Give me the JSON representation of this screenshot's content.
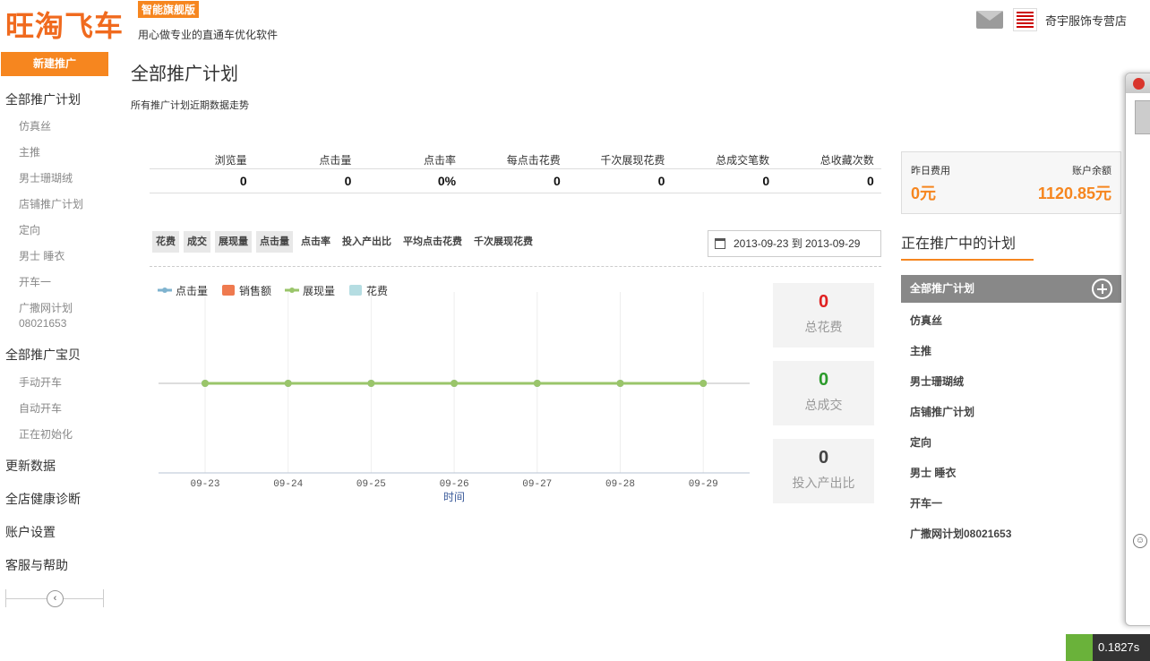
{
  "header": {
    "logo": "旺淘飞车",
    "edition": "智能旗舰版",
    "slogan": "用心做专业的直通车优化软件",
    "shop_name": "奇宇服饰专营店"
  },
  "sidebar": {
    "new_button": "新建推广",
    "groups": [
      {
        "label": "全部推广计划",
        "items": [
          "仿真丝",
          "主推",
          "男士珊瑚绒",
          "店铺推广计划",
          "定向",
          "男士 睡衣",
          "开车一",
          "广撒网计划",
          "08021653"
        ]
      },
      {
        "label": "全部推广宝贝",
        "items": [
          "手动开车",
          "自动开车",
          "正在初始化"
        ]
      },
      {
        "label": "更新数据"
      },
      {
        "label": "全店健康诊断"
      },
      {
        "label": "账户设置"
      },
      {
        "label": "客服与帮助"
      }
    ],
    "collapse_icon": "‹"
  },
  "main": {
    "title": "全部推广计划",
    "subtitle": "所有推广计划近期数据走势",
    "stats": {
      "headers": [
        "浏览量",
        "点击量",
        "点击率",
        "每点击花费",
        "千次展现花费",
        "总成交笔数",
        "总收藏次数"
      ],
      "values": [
        "0",
        "0",
        "0%",
        "0",
        "0",
        "0",
        "0"
      ]
    },
    "metric_tabs": [
      "花费",
      "成交",
      "展现量",
      "点击量",
      "点击率",
      "投入产出比",
      "平均点击花费",
      "千次展现花费"
    ],
    "date_range": "2013-09-23 到 2013-09-29",
    "cards": [
      {
        "value": "0",
        "label": "总花费",
        "color": "#e02020"
      },
      {
        "value": "0",
        "label": "总成交",
        "color": "#2a9a2a"
      },
      {
        "value": "0",
        "label": "投入产出比",
        "color": "#444444"
      }
    ]
  },
  "chart_data": {
    "type": "line",
    "x": [
      "09-23",
      "09-24",
      "09-25",
      "09-26",
      "09-27",
      "09-28",
      "09-29"
    ],
    "xlabel": "时间",
    "series": [
      {
        "name": "点击量",
        "values": [
          0,
          0,
          0,
          0,
          0,
          0,
          0
        ],
        "color": "#7fb3cf",
        "kind": "line"
      },
      {
        "name": "销售额",
        "values": [
          0,
          0,
          0,
          0,
          0,
          0,
          0
        ],
        "color": "#ef7a4f",
        "kind": "bar"
      },
      {
        "name": "展现量",
        "values": [
          0,
          0,
          0,
          0,
          0,
          0,
          0
        ],
        "color": "#9ac56a",
        "kind": "line"
      },
      {
        "name": "花费",
        "values": [
          0,
          0,
          0,
          0,
          0,
          0,
          0
        ],
        "color": "#b5dde2",
        "kind": "bar"
      }
    ],
    "legend": "top-left",
    "grid": true
  },
  "right_panel": {
    "yesterday_cost_label": "昨日费用",
    "yesterday_cost": "0元",
    "balance_label": "账户余额",
    "balance": "1120.85元",
    "running_title": "正在推广中的计划",
    "all_plans": "全部推广计划",
    "plans": [
      "仿真丝",
      "主推",
      "男士珊瑚绒",
      "店铺推广计划",
      "定向",
      "男士 睡衣",
      "开车一",
      "广撒网计划08021653"
    ]
  },
  "timer": "0.1827s",
  "colors": {
    "brand": "#f6861f",
    "logo": "#f06a1e"
  }
}
